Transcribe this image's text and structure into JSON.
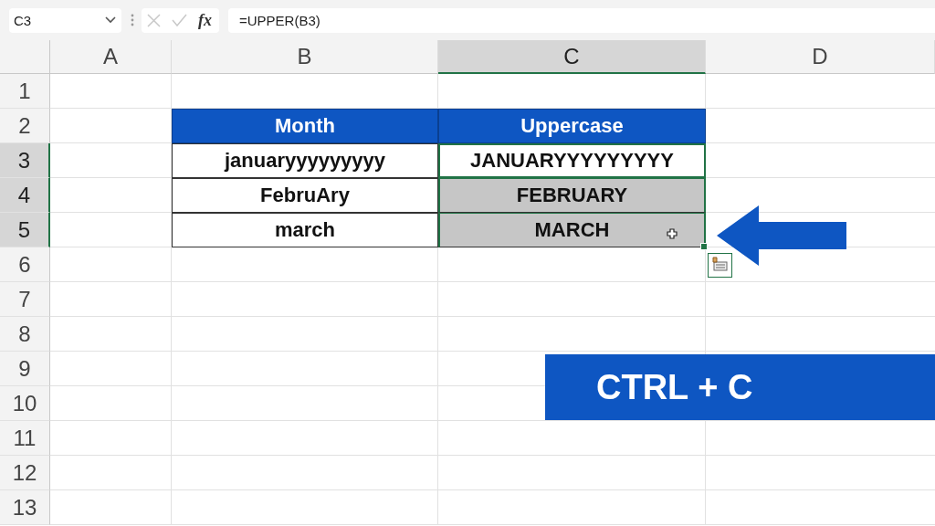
{
  "formula_bar": {
    "name_box": "C3",
    "function_button": "fx",
    "formula": "=UPPER(B3)"
  },
  "columns": [
    {
      "label": "A",
      "selected": false
    },
    {
      "label": "B",
      "selected": false
    },
    {
      "label": "C",
      "selected": true
    },
    {
      "label": "D",
      "selected": false
    }
  ],
  "rows": [
    {
      "label": "1",
      "selected": false
    },
    {
      "label": "2",
      "selected": false
    },
    {
      "label": "3",
      "selected": true
    },
    {
      "label": "4",
      "selected": true
    },
    {
      "label": "5",
      "selected": true
    },
    {
      "label": "6",
      "selected": false
    },
    {
      "label": "7",
      "selected": false
    },
    {
      "label": "8",
      "selected": false
    },
    {
      "label": "9",
      "selected": false
    },
    {
      "label": "10",
      "selected": false
    },
    {
      "label": "11",
      "selected": false
    },
    {
      "label": "12",
      "selected": false
    },
    {
      "label": "13",
      "selected": false
    }
  ],
  "table": {
    "header": [
      "Month",
      "Uppercase"
    ],
    "rows": [
      {
        "month": "januaryyyyyyyyy",
        "uppercase": "JANUARYYYYYYYYY",
        "active": true,
        "selected": false
      },
      {
        "month": "FebruAry",
        "uppercase": "FEBRUARY",
        "active": false,
        "selected": true
      },
      {
        "month": "march",
        "uppercase": "MARCH",
        "active": false,
        "selected": true
      }
    ]
  },
  "banner": "CTRL + C"
}
